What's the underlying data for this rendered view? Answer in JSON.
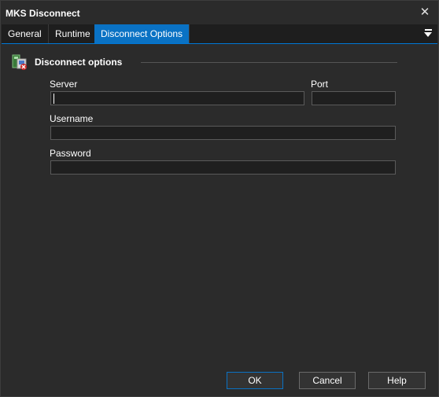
{
  "window": {
    "title": "MKS Disconnect"
  },
  "tabs": [
    {
      "label": "General",
      "active": false
    },
    {
      "label": "Runtime",
      "active": false
    },
    {
      "label": "Disconnect Options",
      "active": true
    }
  ],
  "section": {
    "title": "Disconnect options",
    "icon": "network-disconnect-icon"
  },
  "fields": {
    "server": {
      "label": "Server",
      "value": ""
    },
    "port": {
      "label": "Port",
      "value": ""
    },
    "username": {
      "label": "Username",
      "value": ""
    },
    "password": {
      "label": "Password",
      "value": ""
    }
  },
  "buttons": {
    "ok": "OK",
    "cancel": "Cancel",
    "help": "Help"
  },
  "colors": {
    "background": "#2b2b2b",
    "accent": "#0a72c4",
    "field_bg": "#1f1f1f"
  }
}
